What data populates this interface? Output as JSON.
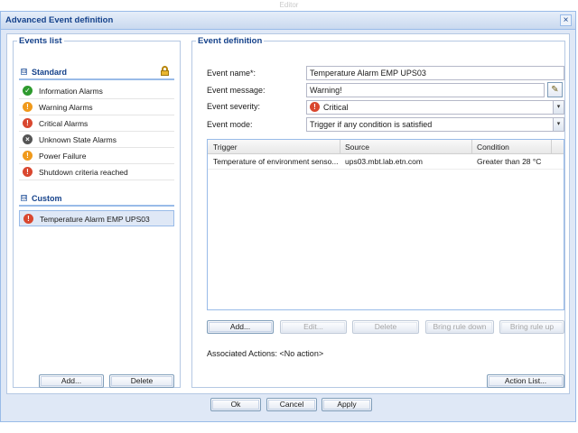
{
  "background_title": "Editor",
  "dialog": {
    "title": "Advanced Event definition",
    "close_glyph": "×"
  },
  "events_list": {
    "legend": "Events list",
    "standard": {
      "label": "Standard",
      "expander_glyph": "⊟",
      "items": [
        {
          "label": "Information Alarms",
          "icon": "check-icon",
          "glyph": "✓"
        },
        {
          "label": "Warning Alarms",
          "icon": "warning-icon",
          "glyph": "!"
        },
        {
          "label": "Critical Alarms",
          "icon": "critical-icon",
          "glyph": "!"
        },
        {
          "label": "Unknown State Alarms",
          "icon": "unknown-icon",
          "glyph": "×"
        },
        {
          "label": "Power Failure",
          "icon": "warning-icon",
          "glyph": "!"
        },
        {
          "label": "Shutdown criteria reached",
          "icon": "critical-icon",
          "glyph": "!"
        }
      ]
    },
    "custom": {
      "label": "Custom",
      "expander_glyph": "⊟",
      "items": [
        {
          "label": "Temperature Alarm EMP UPS03",
          "icon": "critical-icon",
          "glyph": "!",
          "selected": true
        }
      ]
    },
    "add_label": "Add...",
    "delete_label": "Delete"
  },
  "event_definition": {
    "legend": "Event definition",
    "name_label": "Event name*:",
    "name_value": "Temperature Alarm EMP UPS03",
    "message_label": "Event message:",
    "message_value": "Warning!",
    "severity_label": "Event severity:",
    "severity_value": "Critical",
    "mode_label": "Event mode:",
    "mode_value": "Trigger if any condition is satisfied",
    "grid": {
      "columns": [
        "Trigger",
        "Source",
        "Condition"
      ],
      "rows": [
        [
          "Temperature of environment senso...",
          "ups03.mbt.lab.etn.com",
          "Greater than 28 °C"
        ]
      ]
    },
    "rule_buttons": {
      "add": "Add...",
      "edit": "Edit...",
      "delete": "Delete",
      "down": "Bring rule down",
      "up": "Bring rule up"
    },
    "associated_actions": "Associated Actions: <No action>",
    "action_list_label": "Action List..."
  },
  "footer": {
    "ok": "Ok",
    "cancel": "Cancel",
    "apply": "Apply"
  },
  "colors": {
    "frame_border": "#99bbe8",
    "title_text": "#15428b",
    "critical": "#d9472f",
    "warning": "#f09a1c",
    "ok": "#2e9a2e"
  }
}
